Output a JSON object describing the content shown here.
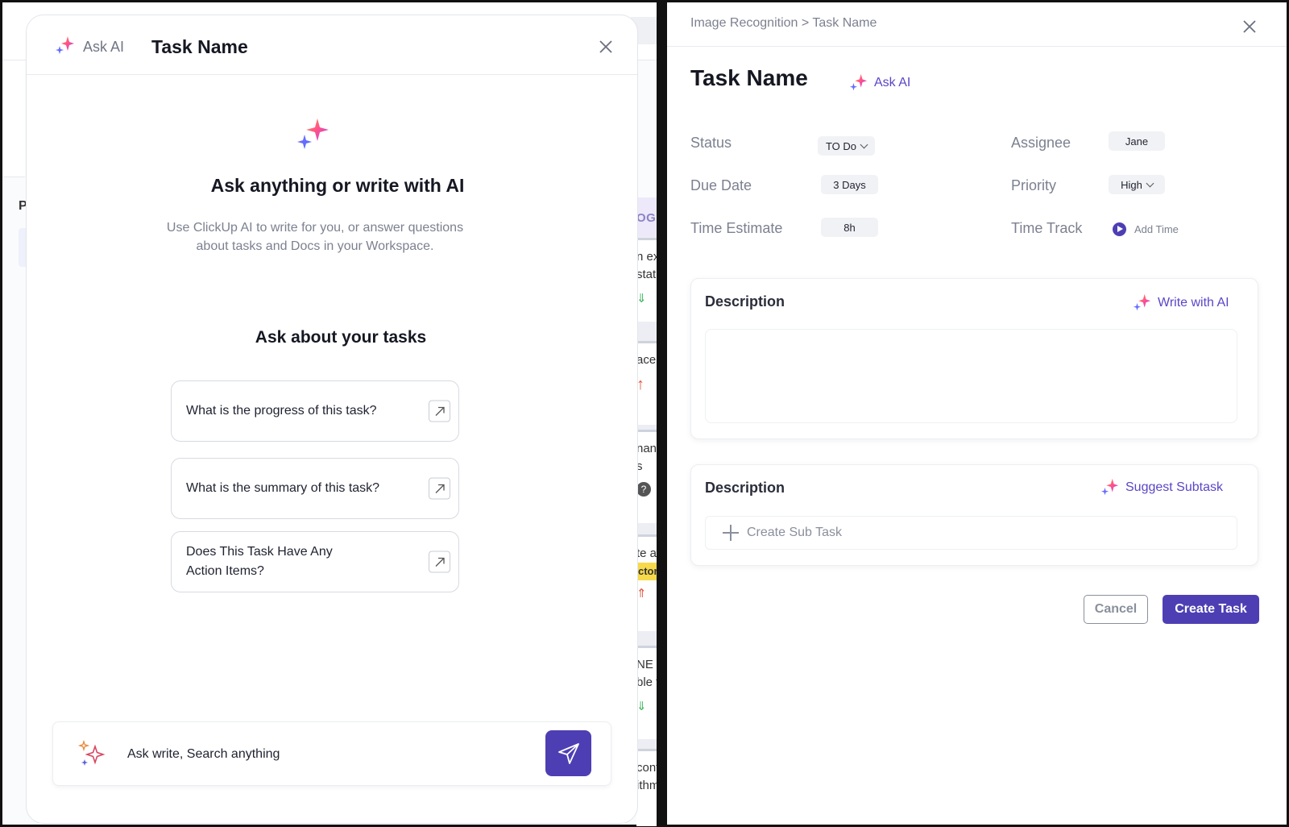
{
  "background": {
    "left_label": "P",
    "column_header": "OGR",
    "cards": [
      {
        "line1": "n ext",
        "line2": "statu",
        "icon": "double-chevron-down-icon"
      },
      {
        "line1": "ace J",
        "line2": "",
        "icon": "arrow-up-icon"
      },
      {
        "line1": "nanua",
        "line2": "s",
        "icon": "question-icon"
      },
      {
        "line1": "te a s",
        "line2": "ctorin",
        "icon": "double-chevron-up-icon"
      },
      {
        "line1": "NE –",
        "line2": "ble to",
        "icon": "double-chevron-down-icon"
      },
      {
        "line1": "cont",
        "line2": "ithm",
        "icon": ""
      }
    ]
  },
  "ai_modal": {
    "header": {
      "ask_label": "Ask AI",
      "title": "Task Name"
    },
    "hero": {
      "title": "Ask anything or write with AI",
      "subtitle": "Use ClickUp AI to write for you, or answer questions about tasks and Docs in your Workspace."
    },
    "section_title": "Ask about your tasks",
    "suggestions": [
      {
        "text": "What is the progress of this task?"
      },
      {
        "text": "What is the summary of this task?"
      },
      {
        "text": "Does This Task Have Any Action Items?"
      }
    ],
    "input": {
      "placeholder": "Ask write, Search anything"
    }
  },
  "task_panel": {
    "breadcrumb": "Image Recognition > Task Name",
    "title": "Task Name",
    "ask_ai_label": "Ask AI",
    "fields": {
      "status_label": "Status",
      "status_value": "TO Do",
      "assignee_label": "Assignee",
      "assignee_value": "Jane",
      "due_label": "Due Date",
      "due_value": "3 Days",
      "priority_label": "Priority",
      "priority_value": "High",
      "estimate_label": "Time Estimate",
      "estimate_value": "8h",
      "track_label": "Time Track",
      "track_action": "Add Time"
    },
    "description_card": {
      "title": "Description",
      "action": "Write with AI"
    },
    "subtask_card": {
      "title": "Description",
      "action": "Suggest Subtask",
      "create_label": "Create Sub Task"
    },
    "buttons": {
      "cancel": "Cancel",
      "create": "Create Task"
    }
  },
  "colors": {
    "accent": "#4d3fb3",
    "link": "#5a46c7"
  }
}
